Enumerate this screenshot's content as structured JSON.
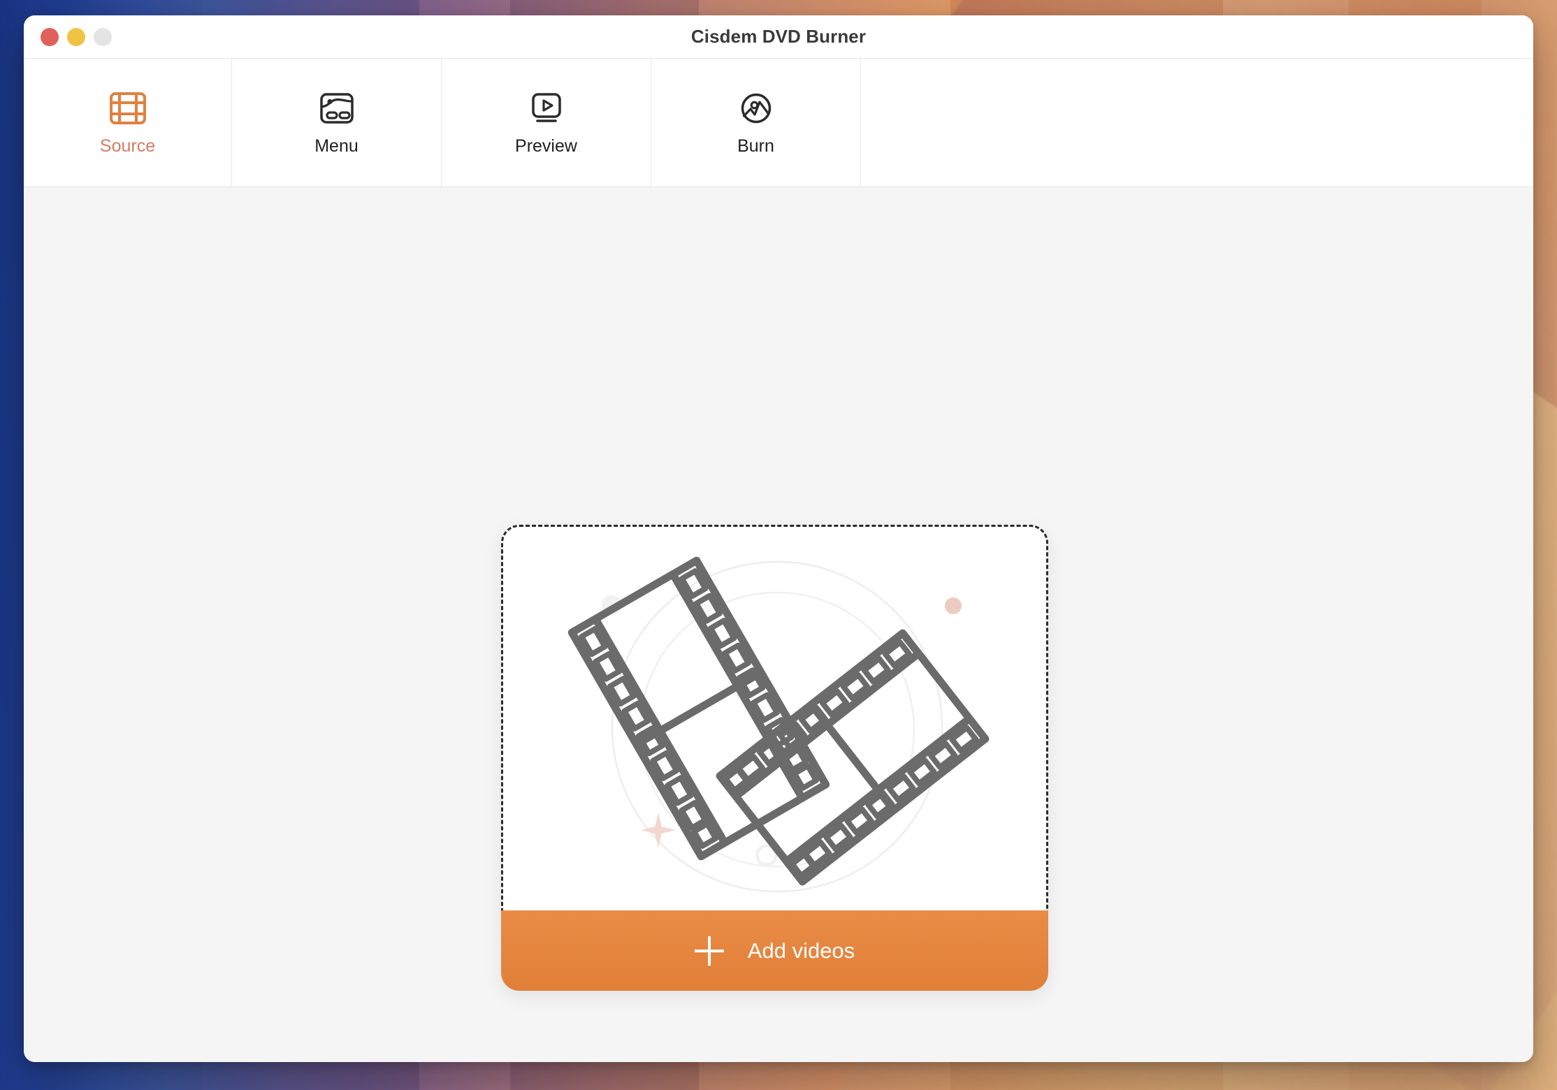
{
  "window": {
    "title": "Cisdem DVD Burner",
    "traffic_lights": [
      {
        "name": "close",
        "color": "#e0615a"
      },
      {
        "name": "minimize",
        "color": "#f0c443"
      },
      {
        "name": "zoom",
        "color": "#e4e4e4"
      }
    ]
  },
  "toolbar": {
    "items": [
      {
        "label": "Source",
        "icon": "film-strip-icon",
        "active": true
      },
      {
        "label": "Menu",
        "icon": "menu-template-icon",
        "active": false
      },
      {
        "label": "Preview",
        "icon": "play-monitor-icon",
        "active": false
      },
      {
        "label": "Burn",
        "icon": "disc-image-icon",
        "active": false
      }
    ]
  },
  "main": {
    "dropzone": {
      "illustration": "two-film-strips-illustration"
    },
    "add_button": {
      "label": "Add videos",
      "icon": "plus-icon"
    }
  },
  "colors": {
    "accent_orange": "#e07f38",
    "active_label": "#d57b63",
    "icon_gray": "#2b2b2b",
    "illustration_gray": "#6b6b6b",
    "decor_pink": "#ecccc0",
    "window_bg": "#f5f5f5"
  }
}
